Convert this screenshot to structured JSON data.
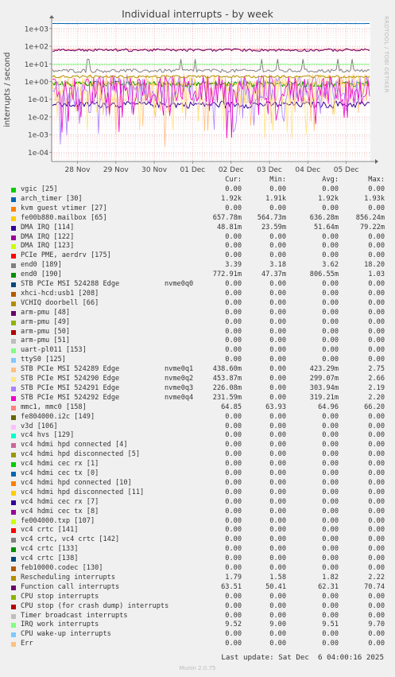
{
  "title": "Individual interrupts - by week",
  "side_brand": "RRDTOOL / TOBI OETIKER",
  "footer": {
    "last_update": "Last update: Sat Dec  6 04:00:16 2025",
    "version": "Munin 2.0.75"
  },
  "legend_header": {
    "cur": "Cur:",
    "min": "Min:",
    "avg": "Avg:",
    "max": "Max:"
  },
  "chart_data": {
    "type": "line",
    "title": "Individual interrupts - by week",
    "ylabel": "interrupts / second",
    "yscale": "log",
    "ylim": [
      3e-05,
      2500
    ],
    "yticks": [
      {
        "value": 1000,
        "label": "1e+03"
      },
      {
        "value": 100,
        "label": "1e+02"
      },
      {
        "value": 10,
        "label": "1e+01"
      },
      {
        "value": 1,
        "label": "1e+00"
      },
      {
        "value": 0.1,
        "label": "1e-01"
      },
      {
        "value": 0.01,
        "label": "1e-02"
      },
      {
        "value": 0.001,
        "label": "1e-03"
      },
      {
        "value": 0.0001,
        "label": "1e-04"
      }
    ],
    "xtick_labels": [
      "28 Nov",
      "29 Nov",
      "30 Nov",
      "01 Dec",
      "02 Dec",
      "03 Dec",
      "04 Dec",
      "05 Dec"
    ],
    "grid": true,
    "legend_position": "bottom",
    "series": [
      {
        "name": "vgic [25]",
        "color": "#00cc00",
        "cur": "0.00",
        "min": "0.00",
        "avg": "0.00",
        "max": "0.00"
      },
      {
        "name": "arch_timer [30]",
        "color": "#0066b3",
        "cur": "1.92k",
        "min": "1.91k",
        "avg": "1.92k",
        "max": "1.93k"
      },
      {
        "name": "kvm guest vtimer [27]",
        "color": "#ff8000",
        "cur": "0.00",
        "min": "0.00",
        "avg": "0.00",
        "max": "0.00"
      },
      {
        "name": "fe00b880.mailbox [65]",
        "color": "#ffcc00",
        "cur": "657.78m",
        "min": "564.73m",
        "avg": "636.28m",
        "max": "856.24m"
      },
      {
        "name": "DMA IRQ [114]",
        "color": "#330099",
        "cur": "48.81m",
        "min": "23.59m",
        "avg": "51.64m",
        "max": "79.22m"
      },
      {
        "name": "DMA IRQ [122]",
        "color": "#990099",
        "cur": "0.00",
        "min": "0.00",
        "avg": "0.00",
        "max": "0.00"
      },
      {
        "name": "DMA IRQ [123]",
        "color": "#ccff00",
        "cur": "0.00",
        "min": "0.00",
        "avg": "0.00",
        "max": "0.00"
      },
      {
        "name": "PCIe PME, aerdrv [175]",
        "color": "#ff0000",
        "cur": "0.00",
        "min": "0.00",
        "avg": "0.00",
        "max": "0.00"
      },
      {
        "name": "end0 [189]",
        "color": "#808080",
        "cur": "3.39",
        "min": "3.18",
        "avg": "3.62",
        "max": "18.20"
      },
      {
        "name": "end0 [190]",
        "color": "#008f00",
        "cur": "772.91m",
        "min": "47.37m",
        "avg": "806.55m",
        "max": "1.03"
      },
      {
        "name": "STB PCIe MSI 524288 Edge",
        "extra": "nvme0q0",
        "color": "#00487d",
        "cur": "0.00",
        "min": "0.00",
        "avg": "0.00",
        "max": "0.00"
      },
      {
        "name": "xhci-hcd:usb1 [208]",
        "color": "#b35a00",
        "cur": "0.00",
        "min": "0.00",
        "avg": "0.00",
        "max": "0.00"
      },
      {
        "name": "VCHIQ doorbell [66]",
        "color": "#b38f00",
        "cur": "0.00",
        "min": "0.00",
        "avg": "0.00",
        "max": "0.00"
      },
      {
        "name": "arm-pmu [48]",
        "color": "#6b006b",
        "cur": "0.00",
        "min": "0.00",
        "avg": "0.00",
        "max": "0.00"
      },
      {
        "name": "arm-pmu [49]",
        "color": "#8fb300",
        "cur": "0.00",
        "min": "0.00",
        "avg": "0.00",
        "max": "0.00"
      },
      {
        "name": "arm-pmu [50]",
        "color": "#b30000",
        "cur": "0.00",
        "min": "0.00",
        "avg": "0.00",
        "max": "0.00"
      },
      {
        "name": "arm-pmu [51]",
        "color": "#bebebe",
        "cur": "0.00",
        "min": "0.00",
        "avg": "0.00",
        "max": "0.00"
      },
      {
        "name": "uart-pl011 [153]",
        "color": "#80ff80",
        "cur": "0.00",
        "min": "0.00",
        "avg": "0.00",
        "max": "0.00"
      },
      {
        "name": "ttyS0 [125]",
        "color": "#80c9ff",
        "cur": "0.00",
        "min": "0.00",
        "avg": "0.00",
        "max": "0.00"
      },
      {
        "name": "STB PCIe MSI 524289 Edge",
        "extra": "nvme0q1",
        "color": "#ffc080",
        "cur": "438.60m",
        "min": "0.00",
        "avg": "423.29m",
        "max": "2.75"
      },
      {
        "name": "STB PCIe MSI 524290 Edge",
        "extra": "nvme0q2",
        "color": "#ffe680",
        "cur": "453.87m",
        "min": "0.00",
        "avg": "299.07m",
        "max": "2.66"
      },
      {
        "name": "STB PCIe MSI 524291 Edge",
        "extra": "nvme0q3",
        "color": "#aa80ff",
        "cur": "226.08m",
        "min": "0.00",
        "avg": "303.94m",
        "max": "2.19"
      },
      {
        "name": "STB PCIe MSI 524292 Edge",
        "extra": "nvme0q4",
        "color": "#ee00cc",
        "cur": "231.59m",
        "min": "0.00",
        "avg": "319.21m",
        "max": "2.20"
      },
      {
        "name": "mmc1, mmc0 [158]",
        "color": "#ff8080",
        "cur": "64.85",
        "min": "63.93",
        "avg": "64.96",
        "max": "66.20"
      },
      {
        "name": "fe804000.i2c [149]",
        "color": "#666600",
        "cur": "0.00",
        "min": "0.00",
        "avg": "0.00",
        "max": "0.00"
      },
      {
        "name": "v3d [106]",
        "color": "#ffbfff",
        "cur": "0.00",
        "min": "0.00",
        "avg": "0.00",
        "max": "0.00"
      },
      {
        "name": "vc4 hvs [129]",
        "color": "#00ffcc",
        "cur": "0.00",
        "min": "0.00",
        "avg": "0.00",
        "max": "0.00"
      },
      {
        "name": "vc4 hdmi hpd connected [4]",
        "color": "#cc6699",
        "cur": "0.00",
        "min": "0.00",
        "avg": "0.00",
        "max": "0.00"
      },
      {
        "name": "vc4 hdmi hpd disconnected [5]",
        "color": "#999900",
        "cur": "0.00",
        "min": "0.00",
        "avg": "0.00",
        "max": "0.00"
      },
      {
        "name": "vc4 hdmi cec rx [1]",
        "color": "#00cc00",
        "cur": "0.00",
        "min": "0.00",
        "avg": "0.00",
        "max": "0.00"
      },
      {
        "name": "vc4 hdmi cec tx [0]",
        "color": "#0066b3",
        "cur": "0.00",
        "min": "0.00",
        "avg": "0.00",
        "max": "0.00"
      },
      {
        "name": "vc4 hdmi hpd connected [10]",
        "color": "#ff8000",
        "cur": "0.00",
        "min": "0.00",
        "avg": "0.00",
        "max": "0.00"
      },
      {
        "name": "vc4 hdmi hpd disconnected [11]",
        "color": "#ffcc00",
        "cur": "0.00",
        "min": "0.00",
        "avg": "0.00",
        "max": "0.00"
      },
      {
        "name": "vc4 hdmi cec rx [7]",
        "color": "#330099",
        "cur": "0.00",
        "min": "0.00",
        "avg": "0.00",
        "max": "0.00"
      },
      {
        "name": "vc4 hdmi cec tx [8]",
        "color": "#990099",
        "cur": "0.00",
        "min": "0.00",
        "avg": "0.00",
        "max": "0.00"
      },
      {
        "name": "fe004000.txp [107]",
        "color": "#ccff00",
        "cur": "0.00",
        "min": "0.00",
        "avg": "0.00",
        "max": "0.00"
      },
      {
        "name": "vc4 crtc [141]",
        "color": "#ff0000",
        "cur": "0.00",
        "min": "0.00",
        "avg": "0.00",
        "max": "0.00"
      },
      {
        "name": "vc4 crtc, vc4 crtc [142]",
        "color": "#808080",
        "cur": "0.00",
        "min": "0.00",
        "avg": "0.00",
        "max": "0.00"
      },
      {
        "name": "vc4 crtc [133]",
        "color": "#008f00",
        "cur": "0.00",
        "min": "0.00",
        "avg": "0.00",
        "max": "0.00"
      },
      {
        "name": "vc4 crtc [138]",
        "color": "#00487d",
        "cur": "0.00",
        "min": "0.00",
        "avg": "0.00",
        "max": "0.00"
      },
      {
        "name": "feb10000.codec [130]",
        "color": "#b35a00",
        "cur": "0.00",
        "min": "0.00",
        "avg": "0.00",
        "max": "0.00"
      },
      {
        "name": "Rescheduling interrupts",
        "color": "#b38f00",
        "cur": "1.79",
        "min": "1.58",
        "avg": "1.82",
        "max": "2.22"
      },
      {
        "name": "Function call interrupts",
        "color": "#6b006b",
        "cur": "63.51",
        "min": "50.41",
        "avg": "62.31",
        "max": "70.74"
      },
      {
        "name": "CPU stop interrupts",
        "color": "#8fb300",
        "cur": "0.00",
        "min": "0.00",
        "avg": "0.00",
        "max": "0.00"
      },
      {
        "name": "CPU stop (for crash dump) interrupts",
        "color": "#b30000",
        "cur": "0.00",
        "min": "0.00",
        "avg": "0.00",
        "max": "0.00"
      },
      {
        "name": "Timer broadcast interrupts",
        "color": "#bebebe",
        "cur": "0.00",
        "min": "0.00",
        "avg": "0.00",
        "max": "0.00"
      },
      {
        "name": "IRQ work interrupts",
        "color": "#80ff80",
        "cur": "9.52",
        "min": "9.00",
        "avg": "9.51",
        "max": "9.70"
      },
      {
        "name": "CPU wake-up interrupts",
        "color": "#80c9ff",
        "cur": "0.00",
        "min": "0.00",
        "avg": "0.00",
        "max": "0.00"
      },
      {
        "name": "Err",
        "color": "#ffc080",
        "cur": "0.00",
        "min": "0.00",
        "avg": "0.00",
        "max": "0.00"
      }
    ]
  }
}
